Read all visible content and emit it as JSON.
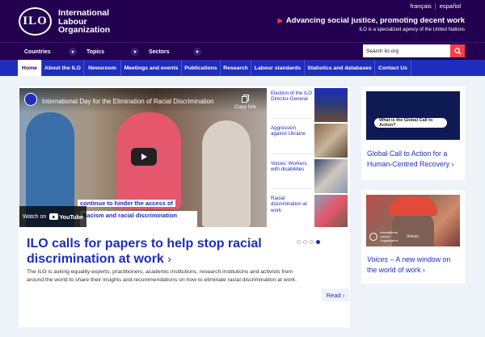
{
  "header": {
    "logo_abbr": "ILO",
    "org_name_lines": [
      "International",
      "Labour",
      "Organization"
    ],
    "languages": [
      "français",
      "español"
    ],
    "slogan": "Advancing social justice, promoting decent work",
    "tagline": "ILO is a specialized agency of the United Nations"
  },
  "dropdowns": [
    {
      "label": "Countries"
    },
    {
      "label": "Topics"
    },
    {
      "label": "Sectors"
    }
  ],
  "search": {
    "value": "Search ilo.org"
  },
  "nav": [
    {
      "label": "Home",
      "active": true
    },
    {
      "label": "About the ILO"
    },
    {
      "label": "Newsroom"
    },
    {
      "label": "Meetings and events"
    },
    {
      "label": "Publications"
    },
    {
      "label": "Research"
    },
    {
      "label": "Labour standards"
    },
    {
      "label": "Statistics and databases"
    },
    {
      "label": "Contact Us"
    }
  ],
  "video": {
    "title": "International Day for the Elimination of Racial Discrimination",
    "copy_link": "Copy link",
    "watch_on": "Watch on",
    "youtube": "YouTube",
    "caption_line1": "Racism and racial discrimination",
    "caption_line2": "continue to hinder the access of"
  },
  "side_items": [
    {
      "label": "Election of the ILO Director-General"
    },
    {
      "label": "Aggression against Ukraine"
    },
    {
      "label": "Voices: Workers with disabilities"
    },
    {
      "label": "Racial discrimination at work"
    }
  ],
  "feature": {
    "headline": "ILO calls for papers to help stop racial discrimination at work",
    "arrow": "›",
    "summary": "The ILO is asking equality experts, practitioners, academic institutions, research institutions and activists from around the world to share their insights and recommendations on how to eliminate racial discrimination at work.",
    "read_label": "Read ›",
    "slider_dots": 4,
    "active_dot": 4
  },
  "cards": [
    {
      "image_text": "What is the Global Call to Action?",
      "title": "Global Call to Action for a Human-Centred Recovery ›"
    },
    {
      "image_badge": "International Labour Organization",
      "image_label": "Voices",
      "title_italic": "Voices",
      "title_rest": " – A new window on the world of work ›"
    }
  ],
  "colors": {
    "header_bg": "#230050",
    "nav_bg": "#1e2dbe",
    "accent_red": "#fa3c4b",
    "link_blue": "#1e2dbe",
    "page_bg": "#eef3f9"
  }
}
